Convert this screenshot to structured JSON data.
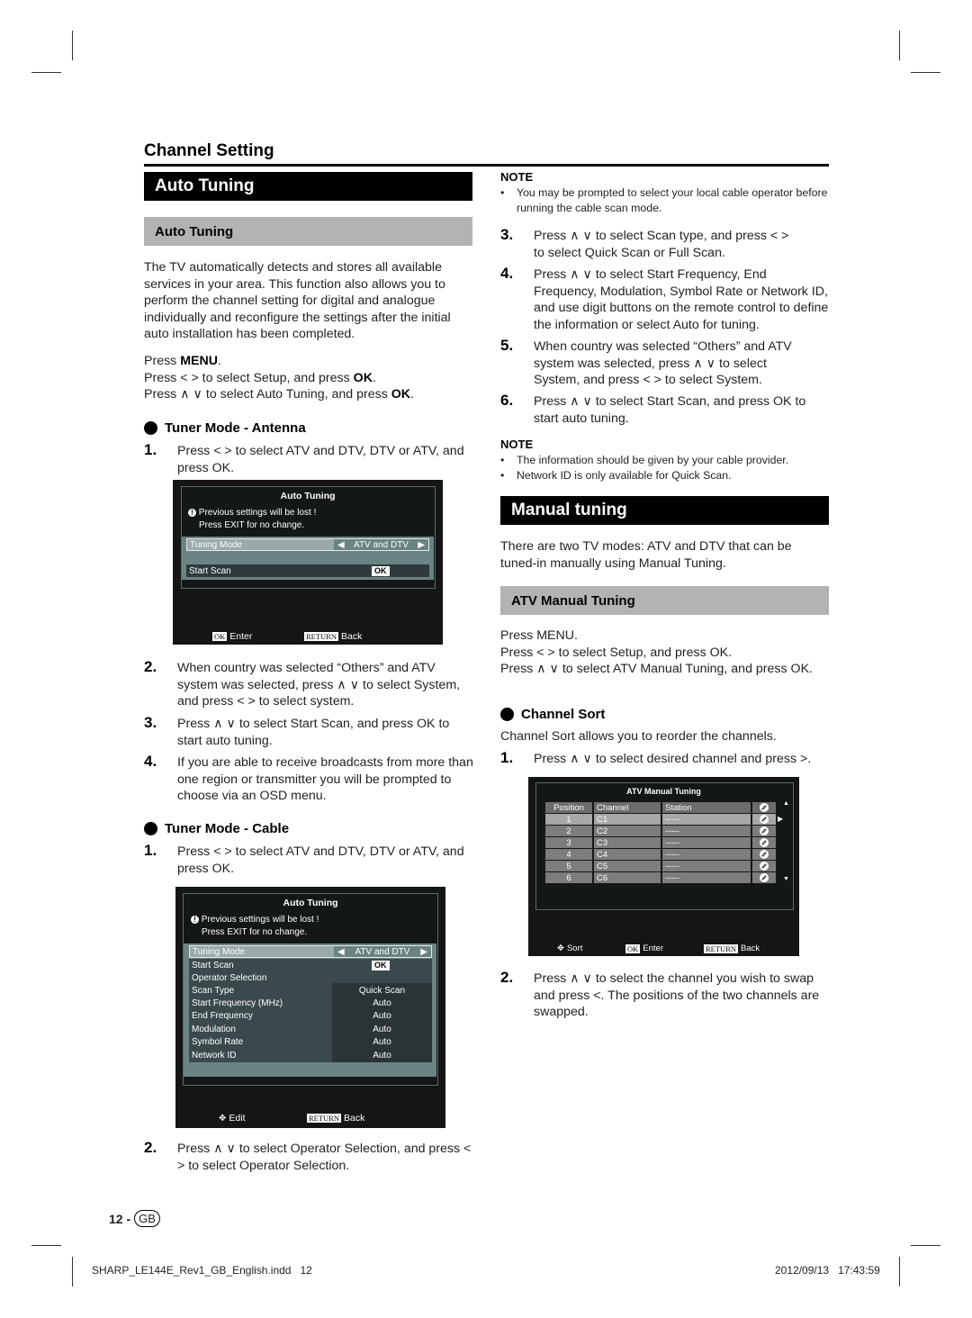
{
  "section_title": "Channel Setting",
  "auto_tuning": {
    "bar_title": "Auto Tuning",
    "sub_title": "Auto Tuning",
    "intro": "The TV automatically detects and stores all available services in your area. This function also allows you to perform the channel setting for digital and analogue individually and reconfigure the settings after the initial auto installation has been completed.",
    "press_menu_pre": "Press ",
    "press_menu_key": "MENU",
    "press_menu_post": ".",
    "press_lr_pre": "Press ",
    "press_lr_icon": "< >",
    "press_lr_mid": " to select Setup, and press ",
    "press_lr_key": "OK",
    "press_lr_post": ".",
    "press_ud_pre": "Press ",
    "press_ud_icon": "∧ ∨",
    "press_ud_mid": " to select Auto Tuning, and press ",
    "press_ud_key": "OK",
    "press_ud_post": ".",
    "antenna": {
      "heading": "Tuner Mode - Antenna",
      "steps": [
        {
          "num": "1.",
          "text": "Press < > to select ATV and DTV, DTV or ATV, and press OK."
        },
        {
          "num": "2.",
          "text": "When country was selected “Others” and ATV system was selected, press ∧ ∨ to select System, and press < > to select system."
        },
        {
          "num": "3.",
          "text": "Press ∧ ∨ to select Start Scan, and press OK to start auto tuning."
        },
        {
          "num": "4.",
          "text": "If you are able to receive broadcasts from more than one region or transmitter you will be prompted to choose via an OSD menu."
        }
      ],
      "osd": {
        "title": "Auto Tuning",
        "warning_line1": "Previous settings will be lost !",
        "warning_line2": "Press EXIT for no change.",
        "rows": [
          {
            "label": "Tuning Mode",
            "value": "ATV and DTV"
          },
          {
            "label": "Start Scan",
            "value": "OK"
          }
        ],
        "footer": [
          {
            "key": "OK",
            "label": "Enter"
          },
          {
            "key": "RETURN",
            "label": "Back"
          }
        ]
      }
    },
    "cable": {
      "heading": "Tuner Mode - Cable",
      "steps": [
        {
          "num": "1.",
          "text": "Press < > to select ATV and DTV, DTV or ATV, and press OK."
        },
        {
          "num": "2.",
          "text": "Press ∧ ∨ to select Operator Selection, and press < > to select Operator Selection."
        },
        {
          "num": "3.",
          "text": "Press ∧ ∨ to select Scan type, and press < > to select Quick Scan or Full Scan."
        },
        {
          "num": "4.",
          "text": "Press ∧ ∨ to select Start Frequency, End Frequency, Modulation, Symbol Rate or Network ID, and use digit buttons on the remote control to define the information or select Auto for tuning."
        },
        {
          "num": "5.",
          "text": "When country was selected “Others” and ATV system was selected, press ∧ ∨ to select System, and press < > to select System."
        },
        {
          "num": "6.",
          "text": "Press ∧ ∨ to select Start Scan, and press OK to start auto tuning."
        }
      ],
      "osd": {
        "title": "Auto Tuning",
        "warning_line1": "Previous settings will be lost !",
        "warning_line2": "Press EXIT for no change.",
        "rows": [
          {
            "label": "Tuning Mode",
            "value": "ATV and DTV"
          },
          {
            "label": "Start Scan",
            "value": "OK"
          },
          {
            "label": "Operator Selection",
            "value": ""
          },
          {
            "label": "Scan Type",
            "value": "Quick Scan"
          },
          {
            "label": "Start Frequency (MHz)",
            "value": "Auto"
          },
          {
            "label": "End Frequency",
            "value": "Auto"
          },
          {
            "label": "Modulation",
            "value": "Auto"
          },
          {
            "label": "Symbol Rate",
            "value": "Auto"
          },
          {
            "label": "Network ID",
            "value": "Auto"
          }
        ],
        "footer": [
          {
            "key": "",
            "label": "Edit"
          },
          {
            "key": "RETURN",
            "label": "Back"
          }
        ]
      }
    },
    "note1": {
      "heading": "NOTE",
      "items": [
        "You may be prompted to select your local cable operator before running the cable scan mode."
      ]
    },
    "note2": {
      "heading": "NOTE",
      "items": [
        "The information should be given by your cable provider.",
        "Network ID is only available for Quick Scan."
      ]
    }
  },
  "manual_tuning": {
    "bar_title": "Manual tuning",
    "intro": "There are two TV modes: ATV and DTV that can be tuned-in manually using Manual Tuning.",
    "sub_title": "ATV Manual Tuning",
    "press_menu": "Press MENU.",
    "press_lr": "Press < > to select Setup, and press OK.",
    "press_ud": "Press ∧ ∨ to select ATV Manual Tuning, and press OK.",
    "channel_sort": {
      "heading": "Channel Sort",
      "intro": "Channel Sort allows you to reorder the channels.",
      "steps": [
        {
          "num": "1.",
          "text": "Press ∧ ∨ to select desired channel and press >."
        },
        {
          "num": "2.",
          "text": "Press ∧ ∨ to select the channel you wish to swap and press <. The positions of the two channels are swapped."
        }
      ],
      "osd": {
        "title": "ATV Manual Tuning",
        "columns": [
          "Position",
          "Channel",
          "Station",
          "skip-icon"
        ],
        "rows": [
          {
            "position": "1",
            "channel": "C1",
            "station": "-----"
          },
          {
            "position": "2",
            "channel": "C2",
            "station": "-----"
          },
          {
            "position": "3",
            "channel": "C3",
            "station": "-----"
          },
          {
            "position": "4",
            "channel": "C4",
            "station": "-----"
          },
          {
            "position": "5",
            "channel": "C5",
            "station": "-----"
          },
          {
            "position": "6",
            "channel": "C6",
            "station": "-----"
          }
        ],
        "footer": [
          {
            "key": "",
            "label": "Sort"
          },
          {
            "key": "OK",
            "label": "Enter"
          },
          {
            "key": "RETURN",
            "label": "Back"
          }
        ]
      }
    }
  },
  "page_number": "12 -",
  "page_badge": "GB",
  "slug_file": "SHARP_LE144E_Rev1_GB_English.indd",
  "slug_page": "12",
  "slug_date": "2012/09/13",
  "slug_time": "17:43:59"
}
